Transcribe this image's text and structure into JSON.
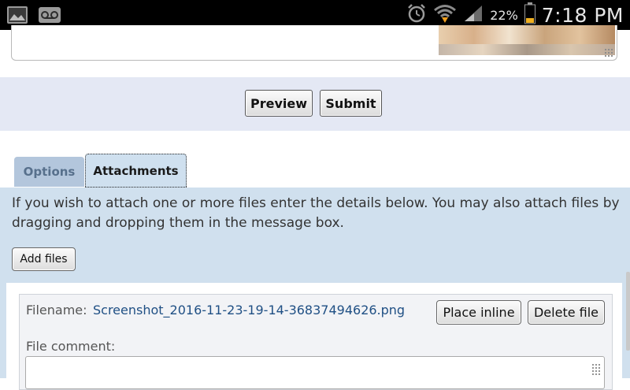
{
  "status_bar": {
    "time": "7:18 PM",
    "battery_percent": "22%",
    "icons": [
      "image-icon",
      "voicemail-icon",
      "alarm-icon",
      "wifi-icon",
      "signal-icon",
      "battery-icon"
    ]
  },
  "actions": {
    "preview_label": "Preview",
    "submit_label": "Submit"
  },
  "tabs": [
    {
      "label": "Options",
      "active": false
    },
    {
      "label": "Attachments",
      "active": true
    }
  ],
  "attachments": {
    "instructions": "If you wish to attach one or more files enter the details below. You may also attach files by dragging and dropping them in the message box.",
    "add_files_label": "Add files",
    "files": [
      {
        "filename_label": "Filename:",
        "filename": "Screenshot_2016-11-23-19-14-36837494626.png",
        "place_inline_label": "Place inline",
        "delete_label": "Delete file",
        "comment_label": "File comment:",
        "comment_value": ""
      }
    ]
  },
  "colors": {
    "status_bar_bg": "#000000",
    "submit_bar_bg": "#e4e8f4",
    "panel_bg": "#d0e0ee",
    "inactive_tab_bg": "#b3c6dc",
    "link_color": "#1f4f84"
  }
}
